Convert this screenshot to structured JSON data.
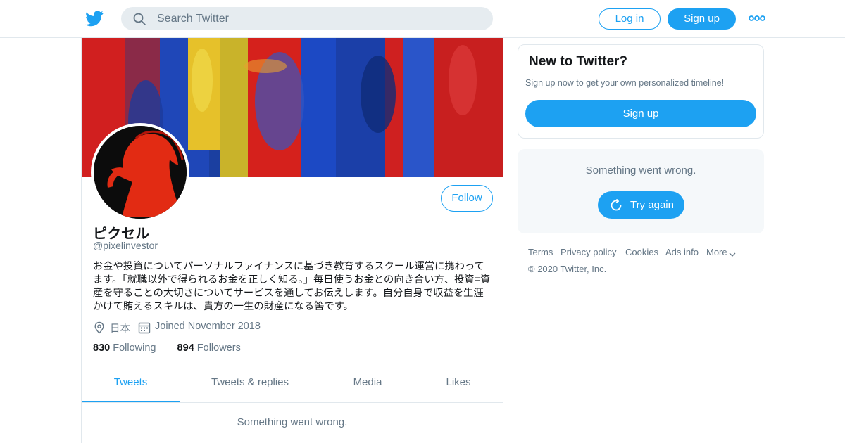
{
  "header": {
    "logo_icon": "twitter-bird-icon",
    "search_placeholder": "Search Twitter",
    "login_label": "Log in",
    "signup_label": "Sign up",
    "more_icon": "more-dots-icon"
  },
  "profile": {
    "display_name": "ピクセル",
    "handle": "@pixelinvestor",
    "bio": "お金や投資についてパーソナルファイナンスに基づき教育するスクール運営に携わってます。「就職以外で得られるお金を正しく知る。」毎日使うお金との向き合い方、投資=資産を守ることの大切さについてサービスを通してお伝えします。自分自身で収益を生涯かけて賄えるスキルは、貴方の一生の財産になる筈です。",
    "location": "日本",
    "joined": "Joined November 2018",
    "following_count": "830",
    "following_label": "Following",
    "followers_count": "894",
    "followers_label": "Followers",
    "follow_label": "Follow"
  },
  "tabs": [
    {
      "label": "Tweets",
      "active": true
    },
    {
      "label": "Tweets & replies",
      "active": false
    },
    {
      "label": "Media",
      "active": false
    },
    {
      "label": "Likes",
      "active": false
    }
  ],
  "feed": {
    "error_message": "Something went wrong."
  },
  "sidebar": {
    "new_title": "New to Twitter?",
    "new_subtitle": "Sign up now to get your own personalized timeline!",
    "new_signup_label": "Sign up",
    "error_message": "Something went wrong.",
    "try_again_label": "Try again"
  },
  "footer": {
    "links": [
      "Terms",
      "Privacy policy",
      "Cookies",
      "Ads info",
      "More"
    ],
    "copyright": "© 2020 Twitter, Inc."
  },
  "colors": {
    "accent": "#1da1f2",
    "muted_text": "#657786",
    "border": "#e1e8ed"
  }
}
